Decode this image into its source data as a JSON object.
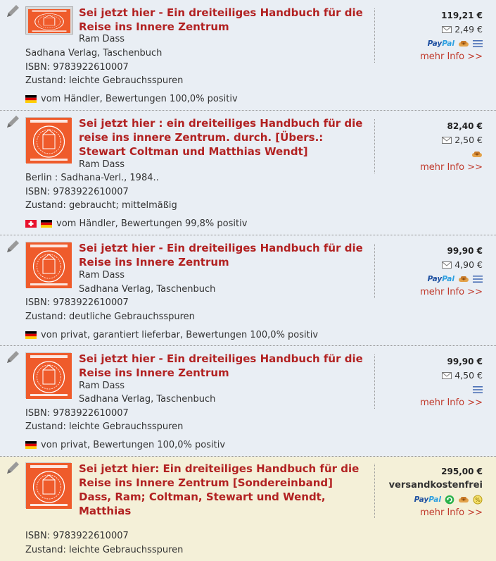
{
  "listings": [
    {
      "title": "Sei jetzt hier - Ein dreiteiliges Handbuch für die Reise ins Innere Zentrum",
      "author": "Ram Dass",
      "publisher": "Sadhana Verlag, Taschenbuch",
      "isbn": "ISBN: 9783922610007",
      "condition": "Zustand: leichte Gebrauchsspuren",
      "seller": "vom Händler, Bewertungen 100,0% positiv",
      "price": "119,21 €",
      "shipping": "2,49 €",
      "more": "mehr Info >>",
      "paypal": "PayPal"
    },
    {
      "title": "Sei jetzt hier : ein dreiteiliges Handbuch für die reise ins innere Zentrum. durch. [Übers.: Stewart Coltman und Matthias Wendt]",
      "author": "Ram Dass",
      "publisher": "Berlin : Sadhana-Verl., 1984..",
      "isbn": "ISBN: 9783922610007",
      "condition": "Zustand: gebraucht; mittelmäßig",
      "seller": "vom Händler, Bewertungen 99,8% positiv",
      "price": "82,40 €",
      "shipping": "2,50 €",
      "more": "mehr Info >>"
    },
    {
      "title": "Sei jetzt hier - Ein dreiteiliges Handbuch für die Reise ins Innere Zentrum",
      "author": "Ram Dass",
      "publisher": "Sadhana Verlag, Taschenbuch",
      "isbn": "ISBN: 9783922610007",
      "condition": "Zustand: deutliche Gebrauchsspuren",
      "seller": "von privat, garantiert lieferbar, Bewertungen 100,0% positiv",
      "price": "99,90 €",
      "shipping": "4,90 €",
      "more": "mehr Info >>",
      "paypal": "PayPal"
    },
    {
      "title": "Sei jetzt hier - Ein dreiteiliges Handbuch für die Reise ins Innere Zentrum",
      "author": "Ram Dass",
      "publisher": "Sadhana Verlag, Taschenbuch",
      "isbn": "ISBN: 9783922610007",
      "condition": "Zustand: leichte Gebrauchsspuren",
      "seller": "von privat, Bewertungen 100,0% positiv",
      "price": "99,90 €",
      "shipping": "4,50 €",
      "more": "mehr Info >>"
    },
    {
      "title": "Sei jetzt hier: Ein dreiteiliges Handbuch für die Reise ins Innere Zentrum [Sondereinband] Dass, Ram; Coltman, Stewart und Wendt, Matthias",
      "isbn": "ISBN: 9783922610007",
      "condition": "Zustand: leichte Gebrauchsspuren",
      "price": "295,00 €",
      "shipping": "versandkostenfrei",
      "more": "mehr Info >>",
      "paypal": "PayPal"
    }
  ],
  "colors": {
    "title": "#b22222",
    "link": "#c0392b",
    "row_bg": "#e9eef4",
    "highlight_bg": "#f4f0d8",
    "cover": "#ef5b2b",
    "paypal_dark": "#1e4fa0",
    "paypal_light": "#2c9fe0"
  },
  "icons": [
    "pencil-icon",
    "envelope-icon",
    "paypal-logo",
    "handshake-icon",
    "list-icon",
    "flag-germany",
    "flag-switzerland",
    "refresh-icon",
    "percent-icon"
  ]
}
